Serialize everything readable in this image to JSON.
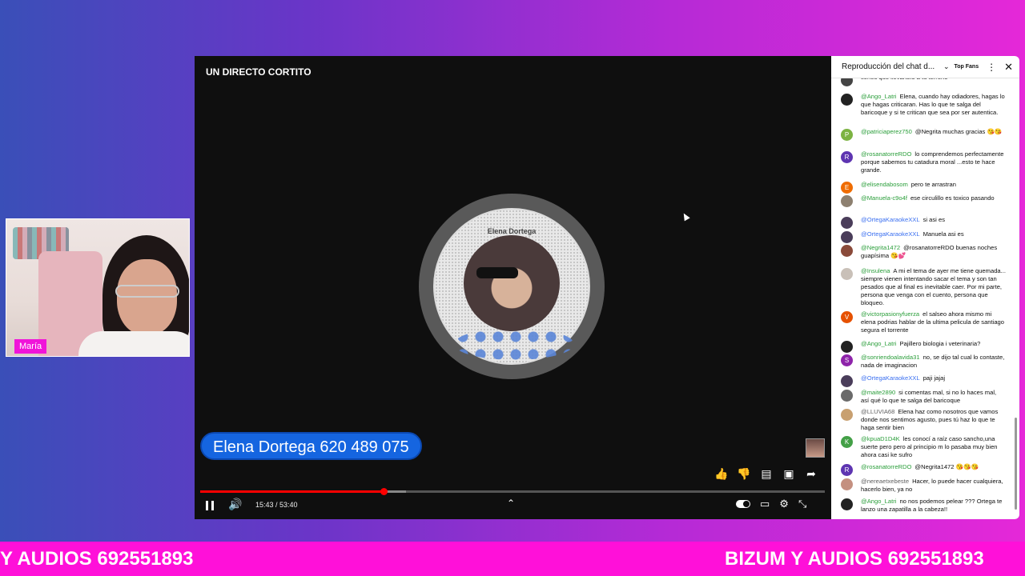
{
  "webcam": {
    "name_tag": "María"
  },
  "player": {
    "title": "UN DIRECTO CORTITO",
    "avatar_ring_text": "Elena Dortega",
    "phone_banner": "Elena Dortega 620 489 075",
    "time": "15:43 / 53:40",
    "progress": {
      "played_fraction": 0.294,
      "loaded_fraction": 0.33
    },
    "icons": [
      "like-icon",
      "dislike-icon",
      "comment-icon",
      "chat-icon",
      "share-icon",
      "pause-icon",
      "volume-icon",
      "autoplay-toggle",
      "subtitles-icon",
      "settings-icon",
      "exit-fullscreen-icon"
    ]
  },
  "chat": {
    "header_title": "Reproducción del chat d...",
    "top_fans": "Top Fans",
    "messages": [
      {
        "author": "",
        "text": "tienes que llevártelo a tu terreno",
        "avatar_letter": "",
        "avatar_color": "#444444",
        "author_class": ""
      },
      {
        "author": "@Ango_Latri",
        "text": "Elena, cuando hay odiadores, hagas lo que hagas criticaran. Has lo que te salga del baricoque y si te critican que sea por ser autentica.",
        "avatar_letter": "",
        "avatar_color": "#222222",
        "author_class": ""
      },
      {
        "author": "@patriciaperez750",
        "text": "@Negrita muchas gracias 😘😘",
        "avatar_letter": "P",
        "avatar_color": "#7cb342",
        "author_class": ""
      },
      {
        "author": "@rosanatorreRDO",
        "text": "lo comprendemos perfectamente porque sabemos tu catadura moral ...esto te hace grande.",
        "avatar_letter": "R",
        "avatar_color": "#5e35b1",
        "author_class": ""
      },
      {
        "author": "@elisendabosom",
        "text": "pero te arrastran",
        "avatar_letter": "E",
        "avatar_color": "#ef6c00",
        "author_class": ""
      },
      {
        "author": "@Manuela-c9o4f",
        "text": "ese circulillo es toxico pasando",
        "avatar_letter": "",
        "avatar_color": "#8d8070",
        "author_class": ""
      },
      {
        "author": "@OrtegaKaraokeXXL",
        "text": "si asi es",
        "avatar_letter": "",
        "avatar_color": "#4a3d5a",
        "author_class": "blue"
      },
      {
        "author": "@OrtegaKaraokeXXL",
        "text": "Manuela asi es",
        "avatar_letter": "",
        "avatar_color": "#4a3d5a",
        "author_class": "blue"
      },
      {
        "author": "@Negrita1472",
        "text": "@rosanatorreRDO buenas noches guapísima 😘💕",
        "avatar_letter": "",
        "avatar_color": "#8a4a3a",
        "author_class": ""
      },
      {
        "author": "@Insulena",
        "text": "A mi el tema de ayer me tiene quemada... siempre vienen intentando sacar el tema y son tan pesados que al final es inevitable caer. Por mi parte, persona que venga con el cuento, persona que bloqueo.",
        "avatar_letter": "",
        "avatar_color": "#c9c0b8",
        "author_class": ""
      },
      {
        "author": "@victorpasionyfuerza",
        "text": "el salseo ahora mismo mi elena podrias hablar de la ultima pelicula de santiago segura el torrente",
        "avatar_letter": "V",
        "avatar_color": "#e65100",
        "author_class": ""
      },
      {
        "author": "@Ango_Latri",
        "text": "Pajillero biologia i veterinaria?",
        "avatar_letter": "",
        "avatar_color": "#222222",
        "author_class": ""
      },
      {
        "author": "@sonriendoalavida31",
        "text": "no, se dijo tal cual lo contaste, nada de imaginacion",
        "avatar_letter": "S",
        "avatar_color": "#8e24aa",
        "author_class": ""
      },
      {
        "author": "@OrtegaKaraokeXXL",
        "text": "paji jajaj",
        "avatar_letter": "",
        "avatar_color": "#4a3d5a",
        "author_class": "blue"
      },
      {
        "author": "@maite2890",
        "text": "si comentas mal, si no lo haces mal, así qué lo que te salga del baricoque",
        "avatar_letter": "",
        "avatar_color": "#6a6a6a",
        "author_class": ""
      },
      {
        "author": "@LLUVIA68",
        "text": "Elena haz como nosotros que vamos donde nos sentimos agusto, pues tú haz lo que te haga sentir bien",
        "avatar_letter": "",
        "avatar_color": "#c8a070",
        "author_class": "gray"
      },
      {
        "author": "@kpuaD1D4K",
        "text": "les conocí a raíz caso sancho,una suerte pero pero al principio m lo pasaba muy bien ahora casi ke sufro",
        "avatar_letter": "K",
        "avatar_color": "#43a047",
        "author_class": ""
      },
      {
        "author": "@rosanatorreRDO",
        "text": "@Negrita1472 😘😘😘",
        "avatar_letter": "R",
        "avatar_color": "#5e35b1",
        "author_class": ""
      },
      {
        "author": "@nereaetxebeste",
        "text": "Hacer, lo puede hacer cualquiera, hacerlo bien, ya no",
        "avatar_letter": "",
        "avatar_color": "#c49080",
        "author_class": "gray"
      },
      {
        "author": "@Ango_Latri",
        "text": "no nos podemos pelear ??? Ortega te lanzo una zapatilla a la cabeza!!",
        "avatar_letter": "",
        "avatar_color": "#222222",
        "author_class": ""
      }
    ]
  },
  "ticker": {
    "left_text": "Y AUDIOS 692551893",
    "right_text": "BIZUM Y AUDIOS 692551893"
  }
}
